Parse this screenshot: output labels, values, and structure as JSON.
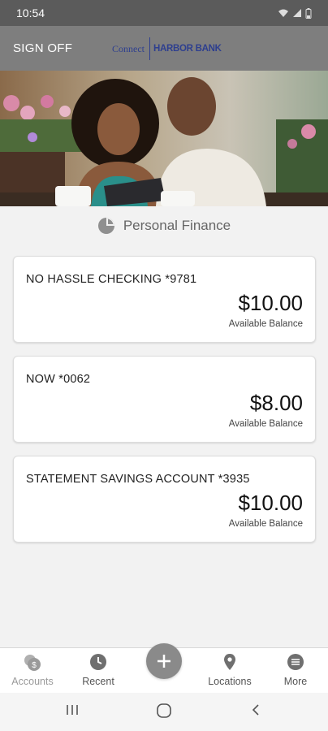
{
  "status_bar": {
    "time": "10:54"
  },
  "header": {
    "sign_off_label": "SIGN OFF",
    "logo_prefix": "Connect",
    "logo_bank": "HARBOR BANK",
    "brand_color": "#2e3f8f"
  },
  "section": {
    "title": "Personal Finance",
    "icon": "pie-chart-icon"
  },
  "accounts": [
    {
      "name": "NO HASSLE CHECKING *9781",
      "amount": "$10.00",
      "label": "Available Balance"
    },
    {
      "name": "NOW *0062",
      "amount": "$8.00",
      "label": "Available Balance"
    },
    {
      "name": "STATEMENT SAVINGS ACCOUNT *3935",
      "amount": "$10.00",
      "label": "Available Balance"
    }
  ],
  "tab_bar": {
    "items": [
      {
        "label": "Accounts",
        "icon": "accounts-icon"
      },
      {
        "label": "Recent",
        "icon": "clock-icon"
      },
      {
        "label": "",
        "icon": "plus-icon"
      },
      {
        "label": "Locations",
        "icon": "location-pin-icon"
      },
      {
        "label": "More",
        "icon": "more-icon"
      }
    ]
  }
}
